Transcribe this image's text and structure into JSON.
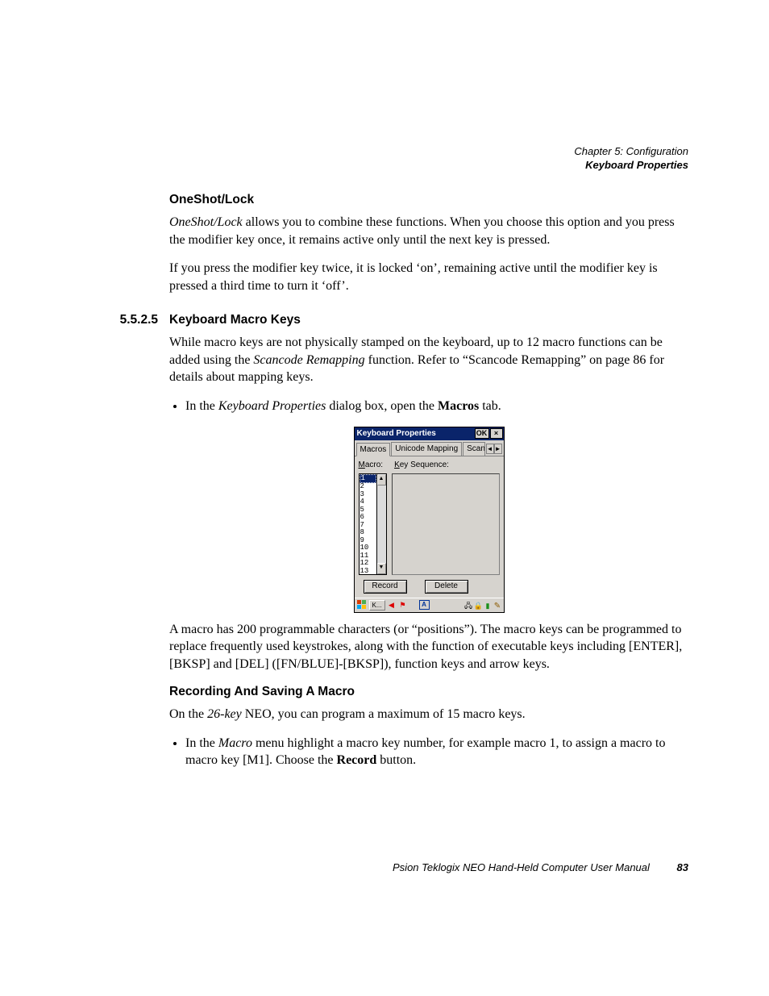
{
  "header": {
    "chapter": "Chapter 5: Configuration",
    "section": "Keyboard Properties"
  },
  "sec_oneshot": {
    "title": "OneShot/Lock",
    "p1_em": "OneShot/Lock",
    "p1_rest": " allows you to combine these functions. When you choose this option and you press the modifier key once, it remains active only until the next key is pressed.",
    "p2": "If you press the modifier key twice, it is locked ‘on’, remaining active until the modifier key is pressed a third time to turn it ‘off’."
  },
  "sec_macro": {
    "number": "5.5.2.5",
    "title": "Keyboard Macro Keys",
    "p1_a": "While macro keys are not physically stamped on the keyboard, up to 12 macro functions can be added using the ",
    "p1_em": "Scancode Remapping",
    "p1_b": " function. Refer to “Scancode Remapping” on page 86 for details about mapping keys.",
    "bullet1_a": "In the ",
    "bullet1_em": "Keyboard Properties",
    "bullet1_b": " dialog box, open the ",
    "bullet1_bold": "Macros",
    "bullet1_c": " tab.",
    "p2": "A macro has 200 programmable characters (or “positions”). The macro keys can be programmed to replace frequently used keystrokes, along with the function of executable keys including [ENTER], [BKSP] and [DEL] ([FN/BLUE]-[BKSP]), function keys and arrow keys."
  },
  "sec_record": {
    "title": "Recording And Saving A Macro",
    "p1_a": "On the ",
    "p1_em": "26-key",
    "p1_b": " NEO, you can program a maximum of 15 macro keys.",
    "bullet1_a": "In the ",
    "bullet1_em": "Macro",
    "bullet1_b": " menu highlight a macro key number, for example macro 1, to assign a macro to macro key [M1]. Choose the ",
    "bullet1_bold": "Record",
    "bullet1_c": " button."
  },
  "dialog": {
    "title": "Keyboard Properties",
    "ok": "OK",
    "close": "×",
    "tabs": {
      "macros": "Macros",
      "unicode": "Unicode Mapping",
      "scancode": "Scanco"
    },
    "labels": {
      "macro": "Macro:",
      "macro_u": "M",
      "keyseq": "Key Sequence:",
      "keyseq_u": "K"
    },
    "list": [
      "1",
      "2",
      "3",
      "4",
      "5",
      "6",
      "7",
      "8",
      "9",
      "10",
      "11",
      "12",
      "13"
    ],
    "buttons": {
      "record": "Record",
      "delete": "Delete"
    },
    "taskbar": {
      "task": "K...",
      "arrow": "◀",
      "tray_a": "A"
    }
  },
  "footer": {
    "text": "Psion Teklogix NEO Hand-Held Computer User Manual",
    "page": "83"
  }
}
